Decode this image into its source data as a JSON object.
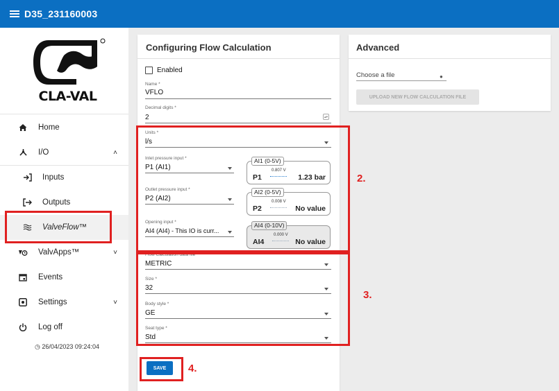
{
  "header": {
    "title": "D35_231160003"
  },
  "sidebar": {
    "logo_text": "CLA-VAL",
    "items": [
      {
        "label": "Home"
      },
      {
        "label": "I/O"
      },
      {
        "label": "Inputs"
      },
      {
        "label": "Outputs"
      },
      {
        "label": "ValveFlow™"
      },
      {
        "label": "ValvApps™"
      },
      {
        "label": "Events"
      },
      {
        "label": "Settings"
      },
      {
        "label": "Log off"
      }
    ],
    "timestamp": "26/04/2023 09:24:04"
  },
  "config": {
    "title": "Configuring Flow Calculation",
    "enabled_label": "Enabled",
    "name_label": "Name *",
    "name_value": "VFLO",
    "decimal_label": "Decimal digits *",
    "decimal_value": "2",
    "units_label": "Units *",
    "units_value": "l/s",
    "inlet_label": "Inlet pressure input *",
    "inlet_value": "P1 (AI1)",
    "outlet_label": "Outlet pressure input *",
    "outlet_value": "P2 (AI2)",
    "opening_label": "Opening input *",
    "opening_value": "AI4 (AI4) - This IO is curr...",
    "ai1": {
      "tag": "AI1 (0-5V)",
      "p": "P1",
      "volt": "0.807 V",
      "result": "1.23 bar"
    },
    "ai2": {
      "tag": "AI2 (0-5V)",
      "p": "P2",
      "volt": "0.008 V",
      "result": "No value"
    },
    "ai4": {
      "tag": "AI4 (0-10V)",
      "p": "AI4",
      "volt": "0.000 V",
      "result": "No value"
    },
    "flowfile_label": "Flow Calculation data file *",
    "flowfile_value": "METRIC",
    "size_label": "Size *",
    "size_value": "32",
    "body_label": "Body style *",
    "body_value": "GE",
    "seat_label": "Seat type *",
    "seat_value": "Std",
    "save_label": "SAVE"
  },
  "advanced": {
    "title": "Advanced",
    "file_placeholder": "Choose a file",
    "upload_label": "UPLOAD NEW FLOW CALCULATION FILE"
  },
  "annotations": {
    "n2": "2.",
    "n3": "3.",
    "n4": "4."
  },
  "colors": {
    "brand_blue": "#0b6fc2",
    "annotation_red": "#e02020"
  }
}
